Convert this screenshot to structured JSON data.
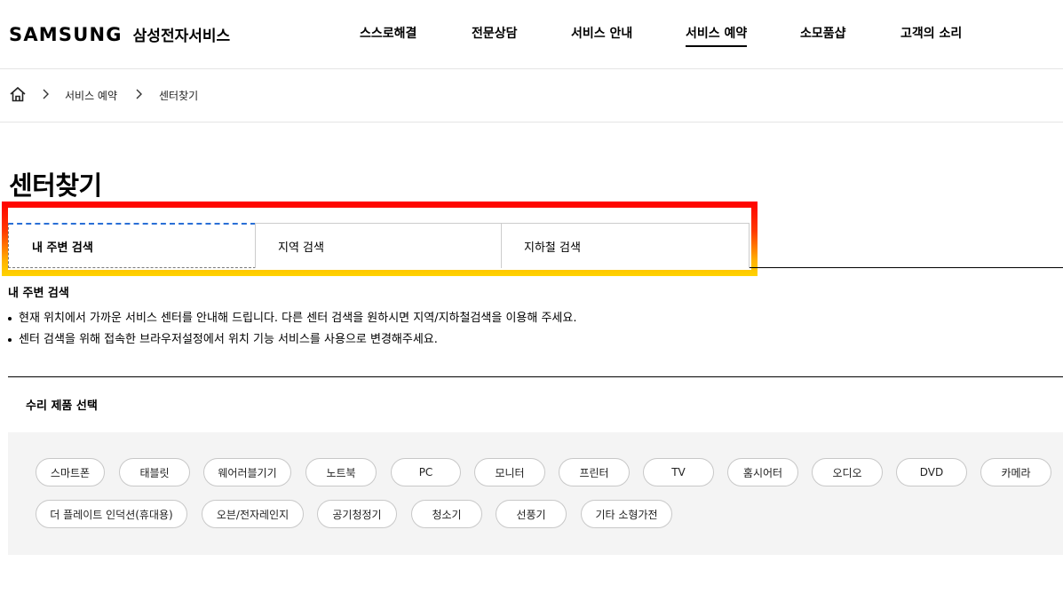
{
  "brand": {
    "wordmark": "SAMSUNG",
    "service_name": "삼성전자서비스"
  },
  "gnb": [
    {
      "label": "스스로해결",
      "active": false
    },
    {
      "label": "전문상담",
      "active": false
    },
    {
      "label": "서비스 안내",
      "active": false
    },
    {
      "label": "서비스 예약",
      "active": true
    },
    {
      "label": "소모품샵",
      "active": false
    },
    {
      "label": "고객의 소리",
      "active": false
    }
  ],
  "breadcrumb": {
    "items": [
      "서비스 예약",
      "센터찾기"
    ]
  },
  "page": {
    "title": "센터찾기"
  },
  "tabs": [
    {
      "label": "내 주변 검색",
      "active": true
    },
    {
      "label": "지역 검색",
      "active": false
    },
    {
      "label": "지하철 검색",
      "active": false
    }
  ],
  "info": {
    "title": "내 주변 검색",
    "bullets": [
      "현재 위치에서 가까운 서비스 센터를 안내해 드립니다. 다른 센터 검색을 원하시면 지역/지하철검색을 이용해 주세요.",
      "센터 검색을 위해 접속한 브라우저설정에서 위치 기능 서비스를 사용으로 변경해주세요."
    ]
  },
  "products": {
    "title": "수리 제품 선택",
    "row1": [
      "스마트폰",
      "태블릿",
      "웨어러블기기",
      "노트북",
      "PC",
      "모니터",
      "프린터",
      "TV",
      "홈시어터",
      "오디오",
      "DVD",
      "카메라"
    ],
    "row2": [
      "더 플레이트 인덕션(휴대용)",
      "오븐/전자레인지",
      "공기청정기",
      "청소기",
      "선풍기",
      "기타 소형가전"
    ]
  },
  "colors": {
    "highlight_top": "#ff0000",
    "highlight_bottom": "#ffd400",
    "active_tab_border": "#2a6fd6"
  }
}
